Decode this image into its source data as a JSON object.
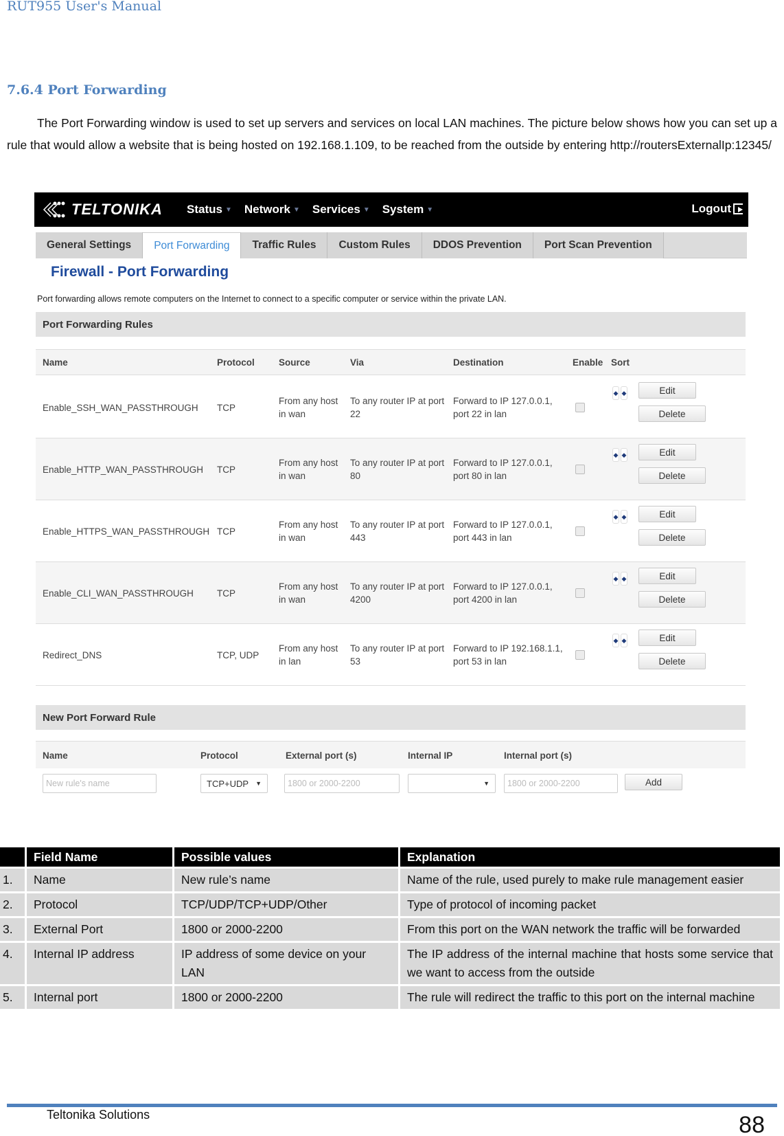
{
  "document": {
    "header": "RUT955 User's Manual",
    "section_title": "7.6.4 Port Forwarding",
    "intro": "The Port Forwarding window is used to set up servers and services on local LAN machines. The picture below shows how you can set up a rule that would allow a website that is being hosted on 192.168.1.109, to be reached from the outside by entering http://routersExternalIp:12345/",
    "footer_company": "Teltonika Solutions",
    "page_number": "88",
    "accent_color": "#4f81bd"
  },
  "router_ui": {
    "brand": "TELTONIKA",
    "nav": [
      "Status",
      "Network",
      "Services",
      "System"
    ],
    "logout": "Logout",
    "tabs": [
      "General Settings",
      "Port Forwarding",
      "Traffic Rules",
      "Custom Rules",
      "DDOS Prevention",
      "Port Scan Prevention"
    ],
    "active_tab": "Port Forwarding",
    "page_title": "Firewall - Port Forwarding",
    "page_description": "Port forwarding allows remote computers on the Internet to connect to a specific computer or service within the private LAN.",
    "rules_section": "Port Forwarding Rules",
    "rules_columns": [
      "Name",
      "Protocol",
      "Source",
      "Via",
      "Destination",
      "Enable",
      "Sort"
    ],
    "rules": [
      {
        "name": "Enable_SSH_WAN_PASSTHROUGH",
        "protocol": "TCP",
        "source1": "From any host",
        "source2": "in wan",
        "via1": "To any router IP at port",
        "via2": "22",
        "dest1": "Forward to IP 127.0.0.1,",
        "dest2": "port 22 in lan",
        "enabled": false
      },
      {
        "name": "Enable_HTTP_WAN_PASSTHROUGH",
        "protocol": "TCP",
        "source1": "From any host",
        "source2": "in wan",
        "via1": "To any router IP at port",
        "via2": "80",
        "dest1": "Forward to IP 127.0.0.1,",
        "dest2": "port 80 in lan",
        "enabled": false
      },
      {
        "name": "Enable_HTTPS_WAN_PASSTHROUGH",
        "protocol": "TCP",
        "source1": "From any host",
        "source2": "in wan",
        "via1": "To any router IP at port",
        "via2": "443",
        "dest1": "Forward to IP 127.0.0.1,",
        "dest2": "port 443 in lan",
        "enabled": false
      },
      {
        "name": "Enable_CLI_WAN_PASSTHROUGH",
        "protocol": "TCP",
        "source1": "From any host",
        "source2": "in wan",
        "via1": "To any router IP at port",
        "via2": "4200",
        "dest1": "Forward to IP 127.0.0.1,",
        "dest2": "port 4200 in lan",
        "enabled": false
      },
      {
        "name": "Redirect_DNS",
        "protocol": "TCP, UDP",
        "source1": "From any host",
        "source2": "in lan",
        "via1": "To any router IP at port",
        "via2": "53",
        "dest1": "Forward to IP 192.168.1.1,",
        "dest2": "port 53 in lan",
        "enabled": false
      }
    ],
    "edit_label": "Edit",
    "delete_label": "Delete",
    "new_section": "New Port Forward Rule",
    "new_columns": [
      "Name",
      "Protocol",
      "External port (s)",
      "Internal IP",
      "Internal port (s)"
    ],
    "new_name_placeholder": "New rule's name",
    "new_protocol_value": "TCP+UDP",
    "new_ext_port_placeholder": "1800 or 2000-2200",
    "new_internal_ip_value": "",
    "new_int_port_placeholder": "1800 or 2000-2200",
    "add_label": "Add"
  },
  "field_table": {
    "headers": [
      "",
      "Field Name",
      "Possible values",
      "Explanation"
    ],
    "rows": [
      {
        "num": "1.",
        "field": "Name",
        "values": "New rule’s name",
        "explanation": "Name of the rule, used purely to make rule management easier"
      },
      {
        "num": "2.",
        "field": "Protocol",
        "values": "TCP/UDP/TCP+UDP/Other",
        "explanation": "Type of protocol of incoming packet"
      },
      {
        "num": "3.",
        "field": "External Port",
        "values": "1800 or 2000-2200",
        "explanation": "From this port on the WAN network the traffic will be forwarded"
      },
      {
        "num": "4.",
        "field": "Internal IP address",
        "values": "IP address of some device on your LAN",
        "explanation": "The IP address of the internal machine that hosts some service that we want to access from the outside"
      },
      {
        "num": "5.",
        "field": "Internal port",
        "values": "1800 or 2000-2200",
        "explanation": "The rule will redirect the traffic to this port on the internal machine"
      }
    ]
  }
}
